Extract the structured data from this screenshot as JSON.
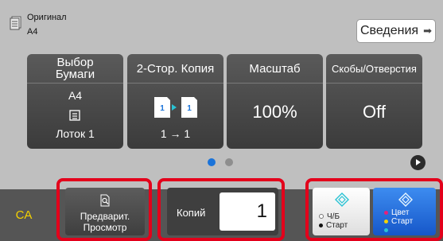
{
  "header": {
    "original_label": "Оригинал",
    "original_size": "A4",
    "details_label": "Сведения"
  },
  "tiles": {
    "paper": {
      "title": "Выбор Бумаги",
      "size": "A4",
      "tray": "Лоток 1"
    },
    "duplex": {
      "title": "2-Стор. Копия",
      "value": "1 → 1"
    },
    "scale": {
      "title": "Масштаб",
      "value": "100%"
    },
    "staple": {
      "title": "Скобы/Отверстия",
      "value": "Off"
    }
  },
  "pager": {
    "page_count": 2,
    "current_page": 1
  },
  "bottom": {
    "ca_label": "CA",
    "preview_label_1": "Предварит.",
    "preview_label_2": "Просмотр",
    "copies_label": "Копий",
    "copies_value": "1",
    "bw_label_1": "Ч/Б",
    "bw_label_2": "Старт",
    "color_label_1": "Цвет",
    "color_label_2": "Старт"
  },
  "colors": {
    "accent": "#1a73d9",
    "highlight": "#e3001b",
    "ca_text": "#f5d200",
    "start_icon": "#29c3d4"
  },
  "icons": {
    "original": "document-icon",
    "details": "arrow-right-icon",
    "tray": "tray-icon",
    "duplex": "duplex-copy-icon",
    "preview": "magnifier-icon",
    "start": "diamond-start-icon",
    "next": "play-next-icon"
  }
}
